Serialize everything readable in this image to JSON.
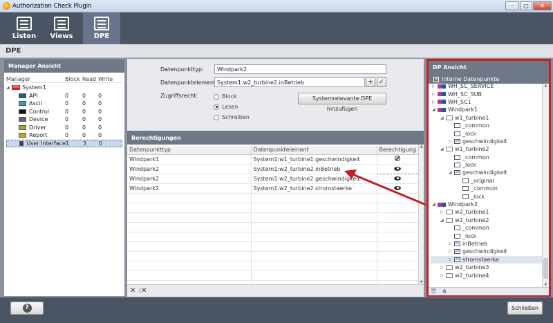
{
  "window": {
    "title": "Authorization Check Plugin",
    "min": "–",
    "max": "□",
    "close": "✕"
  },
  "toolbar": {
    "items": [
      {
        "label": "Listen"
      },
      {
        "label": "Views"
      },
      {
        "label": "DPE"
      }
    ]
  },
  "crumb": "DPE",
  "manager": {
    "title": "Manager Ansicht",
    "cols": [
      "Manager",
      "Block",
      "Read",
      "Write"
    ],
    "root": "System1",
    "root_badge": "SYS",
    "rows": [
      {
        "name": "API",
        "color": "#1f5f7a",
        "b": "0",
        "r": "0",
        "w": "0"
      },
      {
        "name": "Ascii",
        "color": "#2d9fd3",
        "b": "0",
        "r": "0",
        "w": "0"
      },
      {
        "name": "Control",
        "color": "#151515",
        "b": "0",
        "r": "0",
        "w": "0"
      },
      {
        "name": "Device",
        "color": "#5d6670",
        "b": "0",
        "r": "0",
        "w": "0"
      },
      {
        "name": "Driver",
        "color": "#9aa92a",
        "b": "0",
        "r": "0",
        "w": "0"
      },
      {
        "name": "Report",
        "color": "#b7a72c",
        "b": "0",
        "r": "0",
        "w": "0"
      },
      {
        "name": "User Interface",
        "color": "#4a2e7a",
        "b": "1",
        "r": "3",
        "w": "0"
      }
    ]
  },
  "form": {
    "type_label": "Datenpunkttyp:",
    "type_value": "Windpark2",
    "element_label": "Datenpunktelement:",
    "element_value": "System1:w2_turbine2.inBetrieb",
    "add": "+",
    "ok": "✓",
    "access_label": "Zugriffsrecht:",
    "access_options": [
      "Block",
      "Lesen",
      "Schreiben"
    ],
    "sys_button": "Systemrelevante DPE hinzufügen"
  },
  "perms": {
    "title": "Berechtigungen",
    "cols": [
      "Datenpunkttyp",
      "Datenpunktelement",
      "Berechtigung"
    ],
    "rows": [
      {
        "type": "Windpark1",
        "element": "System1:w1_turbine1.geschwindigkeit",
        "perm": "block"
      },
      {
        "type": "Windpark2",
        "element": "System1:w2_turbine2.inBetrieb",
        "perm": "read"
      },
      {
        "type": "Windpark2",
        "element": "System1:w2_turbine2.geschwindigkeit",
        "perm": "read"
      },
      {
        "type": "Windpark2",
        "element": "System1:w2_turbine2.stromstaerke",
        "perm": "read"
      }
    ],
    "del": "✕",
    "del_all": "⁝✕"
  },
  "dp": {
    "title": "DP Ansicht",
    "internal": "Interne Datenpunkte",
    "tree": [
      {
        "d": 0,
        "k": "dpt",
        "t": "WH_SC_SERVICE",
        "a": "▷"
      },
      {
        "d": 0,
        "k": "dpt",
        "t": "WH_SC_SUB",
        "a": "▷"
      },
      {
        "d": 0,
        "k": "dpt",
        "t": "WH_SC1",
        "a": "▷"
      },
      {
        "d": 0,
        "k": "dpt",
        "t": "Windpark1",
        "a": "◢"
      },
      {
        "d": 1,
        "k": "fold",
        "t": "w1_turbine1",
        "a": "◢"
      },
      {
        "d": 2,
        "k": "el",
        "t": "_common",
        "i": ""
      },
      {
        "d": 2,
        "k": "el",
        "t": "_lock",
        "i": ""
      },
      {
        "d": 2,
        "k": "el",
        "t": "geschwindigkeit",
        "a": "▷",
        "i": "20"
      },
      {
        "d": 1,
        "k": "fold",
        "t": "w1_turbine2",
        "a": "◢"
      },
      {
        "d": 2,
        "k": "el",
        "t": "_common",
        "i": ""
      },
      {
        "d": 2,
        "k": "el",
        "t": "_lock",
        "i": ""
      },
      {
        "d": 2,
        "k": "el",
        "t": "geschwindigkeit",
        "a": "◢",
        "i": "20"
      },
      {
        "d": 3,
        "k": "el",
        "t": "_original",
        "i": ""
      },
      {
        "d": 3,
        "k": "el",
        "t": "_common",
        "i": ""
      },
      {
        "d": 3,
        "k": "el",
        "t": "_lock",
        "i": ""
      },
      {
        "d": 0,
        "k": "dpt",
        "t": "Windpark2",
        "a": "◢"
      },
      {
        "d": 1,
        "k": "fold",
        "t": "w2_turbine1",
        "a": "▷"
      },
      {
        "d": 1,
        "k": "fold",
        "t": "w2_turbine2",
        "a": "◢"
      },
      {
        "d": 2,
        "k": "el",
        "t": "_common",
        "i": ""
      },
      {
        "d": 2,
        "k": "el",
        "t": "_lock",
        "i": ""
      },
      {
        "d": 2,
        "k": "el",
        "t": "inBetrieb",
        "a": "▷",
        "i": "01"
      },
      {
        "d": 2,
        "k": "el",
        "t": "geschwindigkeit",
        "a": "▷",
        "i": "20"
      },
      {
        "d": 2,
        "k": "el",
        "t": "stromstaerke",
        "a": "▷",
        "i": "20",
        "sel": true
      },
      {
        "d": 1,
        "k": "fold",
        "t": "w2_turbine3",
        "a": "▷"
      },
      {
        "d": 1,
        "k": "fold",
        "t": "w2_turbine4",
        "a": "▷"
      }
    ]
  },
  "footer": {
    "help": "?",
    "close": "Schließen"
  }
}
